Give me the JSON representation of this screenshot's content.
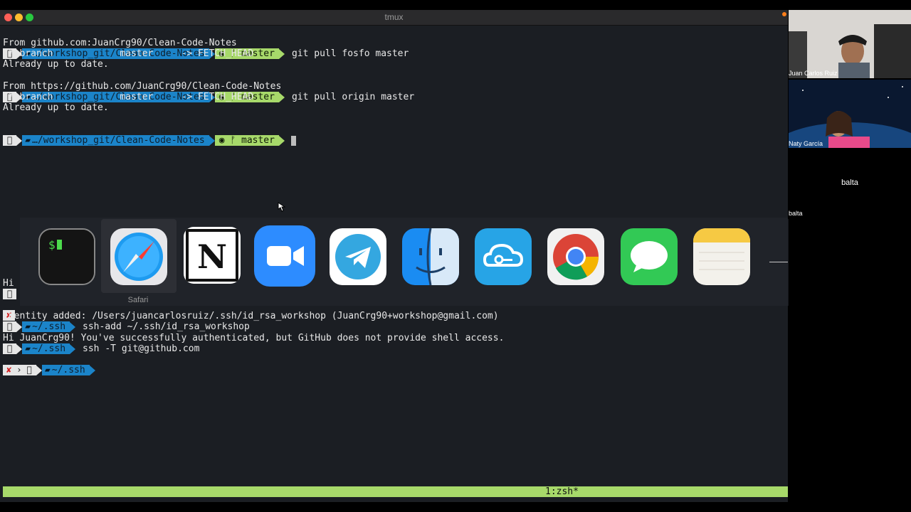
{
  "window": {
    "title": "tmux"
  },
  "prompt": {
    "os_icon": "apple-icon",
    "dir_full": "…/workshop_git/Clean-Code-Notes",
    "dir_ssh": "~/.ssh",
    "branch": "master",
    "git_glyph": "ᚠ"
  },
  "terminal": {
    "top": [
      {
        "type": "prompt",
        "cmd": "git pull fosfo master"
      },
      {
        "type": "text",
        "text": "From github.com:JuanCrg90/Clean-Code-Notes"
      },
      {
        "type": "text",
        "text": " * branch            master     -> FETCH_HEAD"
      },
      {
        "type": "text",
        "text": "Already up to date."
      },
      {
        "type": "prompt",
        "cmd": "git pull origin master"
      },
      {
        "type": "text",
        "text": "From https://github.com/JuanCrg90/Clean-Code-Notes"
      },
      {
        "type": "text",
        "text": " * branch            master     -> FETCH_HEAD"
      },
      {
        "type": "text",
        "text": "Already up to date."
      },
      {
        "type": "prompt_cursor",
        "cmd": ""
      }
    ],
    "bottom": {
      "hi_partial": "Hi",
      "x_mark": "✘",
      "cmd_partial": "ssh-add ~/.ssh/id_rsa_workshop",
      "identity": "Identity added: /Users/juancarlosruiz/.ssh/id_rsa_workshop (JuanCrg90+workshop@gmail.com)",
      "cmd_ssh": "ssh -T git@github.com",
      "auth_msg": "Hi JuanCrg90! You've successfully authenticated, but GitHub does not provide shell access."
    },
    "status": "1:zsh*"
  },
  "dock": {
    "apps": [
      {
        "name": "terminal-icon"
      },
      {
        "name": "safari-icon",
        "label": "Safari"
      },
      {
        "name": "notion-icon"
      },
      {
        "name": "zoom-icon"
      },
      {
        "name": "telegram-icon"
      },
      {
        "name": "finder-icon"
      },
      {
        "name": "cloud-key-icon"
      },
      {
        "name": "chrome-icon"
      },
      {
        "name": "messages-icon"
      },
      {
        "name": "notes-icon"
      }
    ],
    "hover_label": "Safari"
  },
  "video": {
    "participants": [
      {
        "name": "Juan Carlos Ruiz"
      },
      {
        "name": "Naty García"
      },
      {
        "name": "balta",
        "center": "balta"
      }
    ]
  }
}
